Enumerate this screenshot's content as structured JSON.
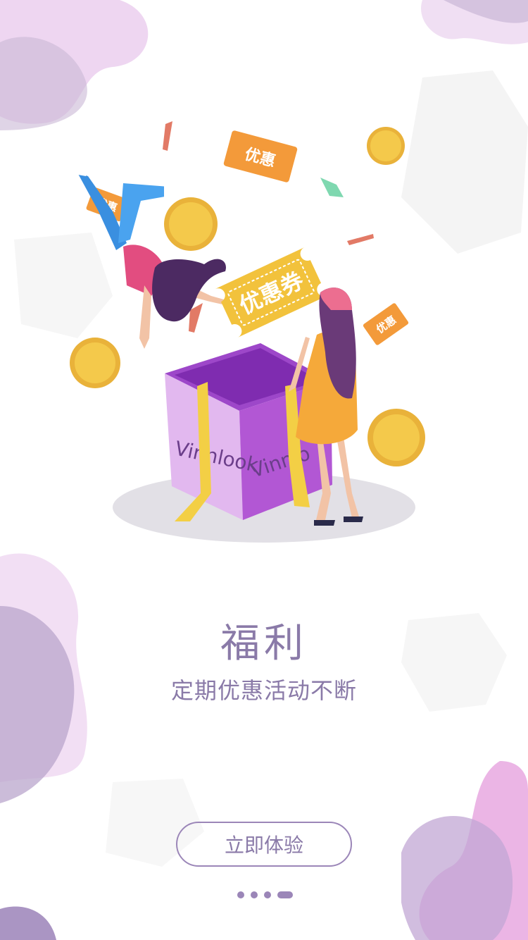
{
  "page": {
    "title": "福利",
    "subtitle": "定期优惠活动不断",
    "cta_label": "立即体验"
  },
  "illustration": {
    "box_brand": "Vinnlook",
    "box_brand_2": "Vinnlo",
    "coupon_large": "优惠券",
    "coupon_small_1": "优惠",
    "coupon_small_2": "优惠",
    "coupon_small_3": "优惠"
  },
  "pagination": {
    "total": 4,
    "active_index": 3
  },
  "colors": {
    "accent": "#8a7aa8",
    "button_border": "#9b86b8",
    "box_purple": "#c77ddf",
    "coin_gold": "#f2c64a",
    "ribbon_yellow": "#f3cf45"
  }
}
